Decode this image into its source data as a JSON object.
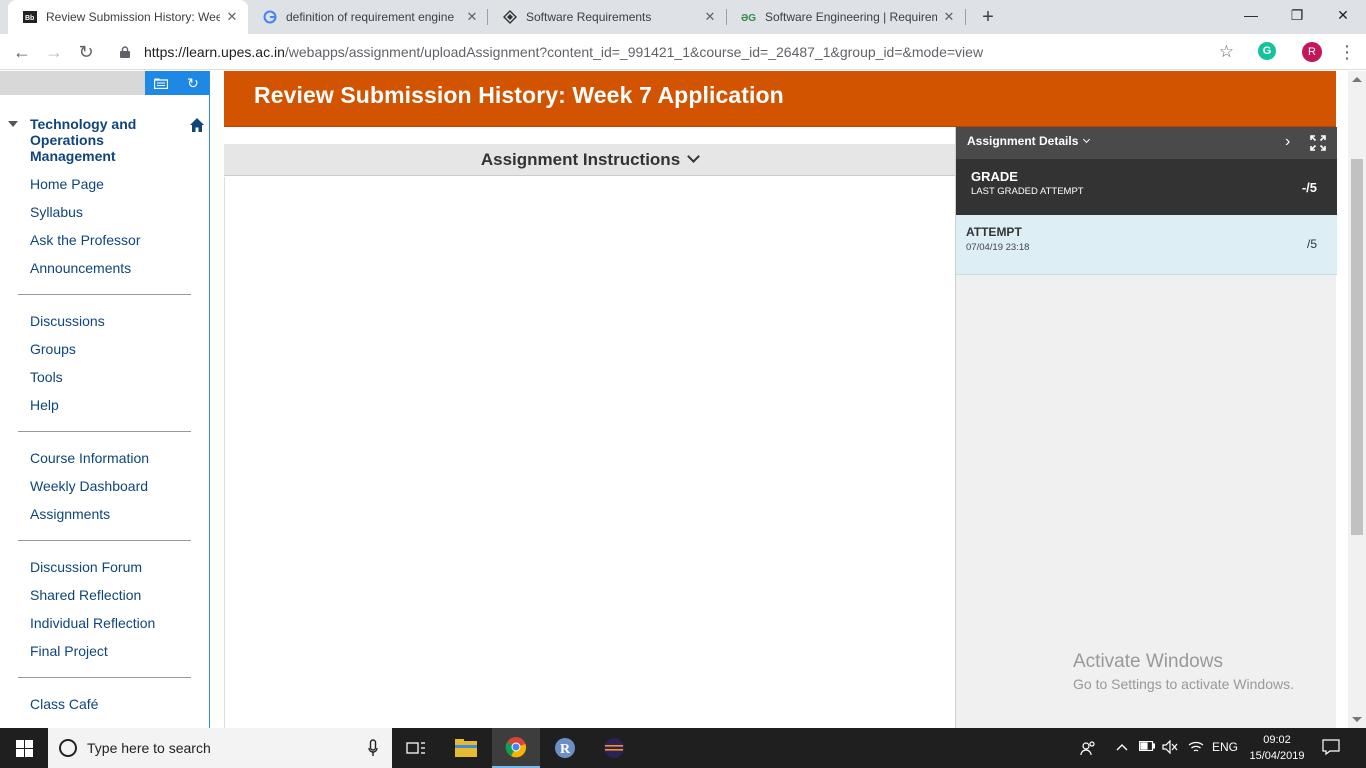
{
  "browser": {
    "tabs": [
      {
        "title": "Review Submission History: Week",
        "active": true,
        "favicon": "blackboard-icon"
      },
      {
        "title": "definition of requirement engine",
        "active": false,
        "favicon": "google-icon"
      },
      {
        "title": "Software Requirements",
        "active": false,
        "favicon": "diamond-icon"
      },
      {
        "title": "Software Engineering | Requirem",
        "active": false,
        "favicon": "geeksforgeeks-icon"
      }
    ],
    "url_host": "https://learn.upes.ac.in",
    "url_path": "/webapps/assignment/uploadAssignment?content_id=_991421_1&course_id=_26487_1&group_id=&mode=view",
    "profile_initial": "R",
    "extension_initial": "G"
  },
  "sidebar": {
    "course_title": "Technology and Operations Management",
    "groups": [
      [
        "Home Page",
        "Syllabus",
        "Ask the Professor",
        "Announcements"
      ],
      [
        "Discussions",
        "Groups",
        "Tools",
        "Help"
      ],
      [
        "Course Information",
        "Weekly Dashboard",
        "Assignments"
      ],
      [
        "Discussion Forum",
        "Shared Reflection",
        "Individual Reflection",
        "Final Project"
      ],
      [
        "Class Café"
      ]
    ]
  },
  "main": {
    "page_title": "Review Submission History: Week 7 Application",
    "instructions_label": "Assignment Instructions"
  },
  "details_panel": {
    "header": "Assignment Details",
    "grade_title": "GRADE",
    "grade_subtitle": "LAST GRADED ATTEMPT",
    "grade_value": "-/5",
    "attempt_title": "ATTEMPT",
    "attempt_date": "07/04/19 23:18",
    "attempt_value": "/5"
  },
  "watermark": {
    "line1": "Activate Windows",
    "line2": "Go to Settings to activate Windows."
  },
  "taskbar": {
    "search_placeholder": "Type here to search",
    "language": "ENG",
    "time": "09:02",
    "date": "15/04/2019"
  },
  "colors": {
    "header_orange": "#d35400",
    "link_blue": "#10457a",
    "panel_dark": "#333333",
    "attempt_bg": "#ddeef5"
  }
}
